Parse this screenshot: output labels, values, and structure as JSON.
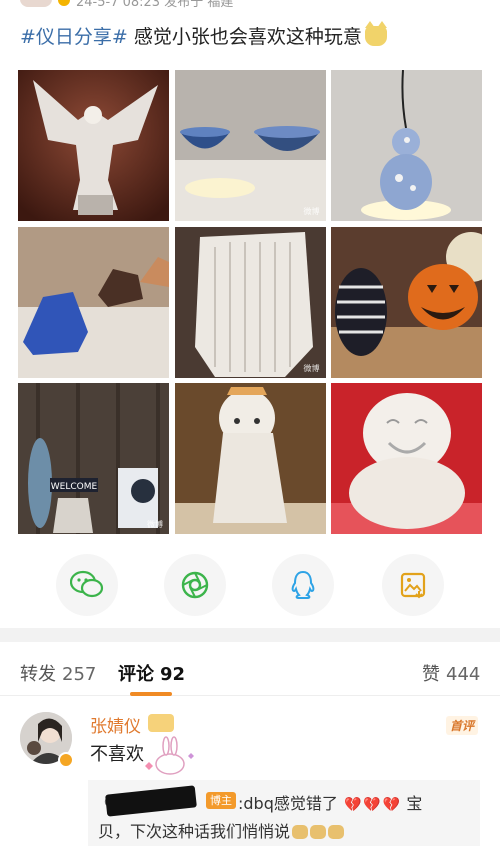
{
  "post": {
    "meta": "24-5-7 08:23  发布于 福建",
    "hashtag": "#仪日分享#",
    "text": " 感觉小张也会喜欢这种玩意",
    "emoji": "doge-icon"
  },
  "share": {
    "buttons": [
      "wechat-icon",
      "moments-icon",
      "qq-icon",
      "save-image-icon"
    ]
  },
  "tabs": {
    "repost_label": "转发",
    "repost_count": "257",
    "comment_label": "评论",
    "comment_count": "92",
    "like_label": "赞",
    "like_count": "444"
  },
  "comment": {
    "name": "张婧仪",
    "first_badge": "首评",
    "body": "不喜欢",
    "reply": {
      "host_badge": "博主",
      "line1": ":dbq感觉错了",
      "line1_tail": "宝",
      "line2": "贝，下次这种话我们悄悄说"
    }
  },
  "colors": {
    "accent": "#f08a24",
    "hashtag": "#3b6ea8",
    "name": "#e07a2f"
  }
}
